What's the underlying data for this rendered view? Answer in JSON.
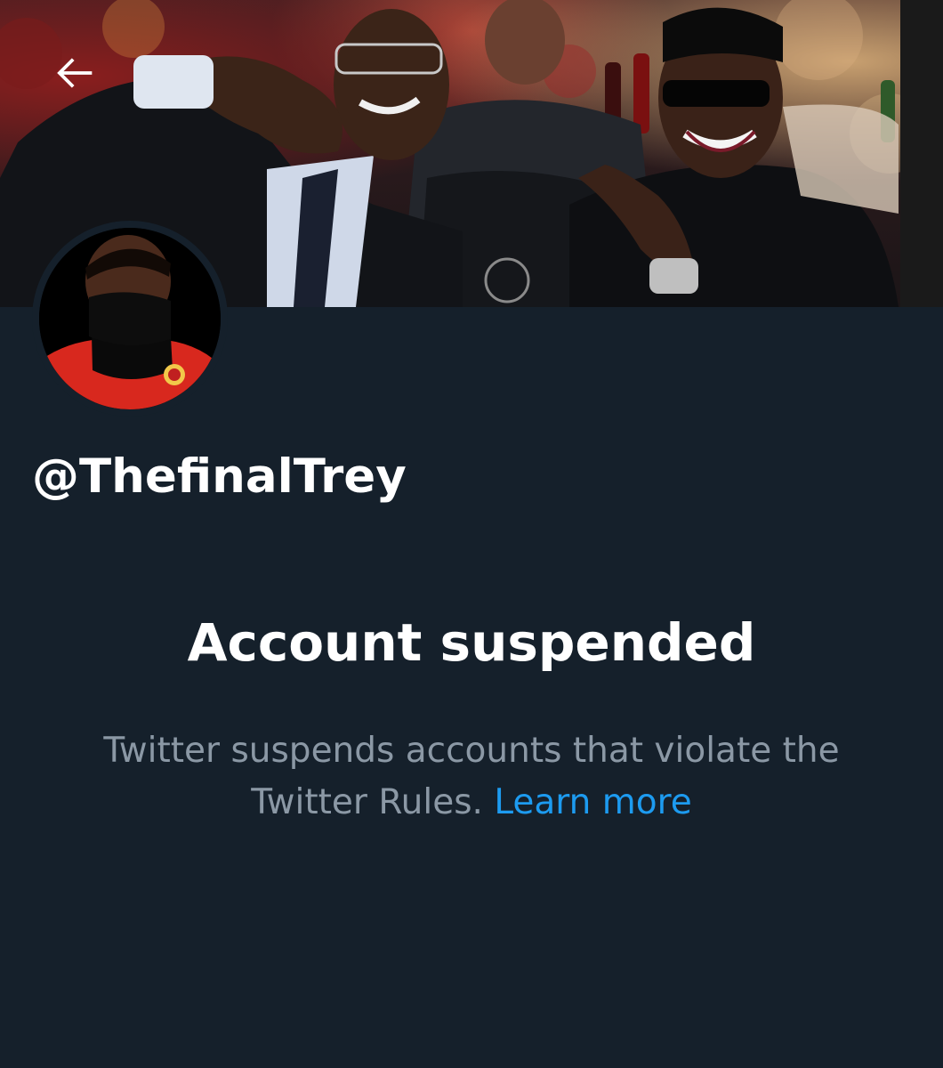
{
  "header": {
    "back_icon": "arrow-left-icon"
  },
  "profile": {
    "handle": "@ThefinalTrey"
  },
  "suspension": {
    "title": "Account suspended",
    "message": "Twitter suspends accounts that violate the Twitter Rules.",
    "link_label": "Learn more"
  },
  "colors": {
    "background": "#15202b",
    "primary_text": "#ffffff",
    "secondary_text": "#8b98a5",
    "link": "#1d9bf0"
  }
}
